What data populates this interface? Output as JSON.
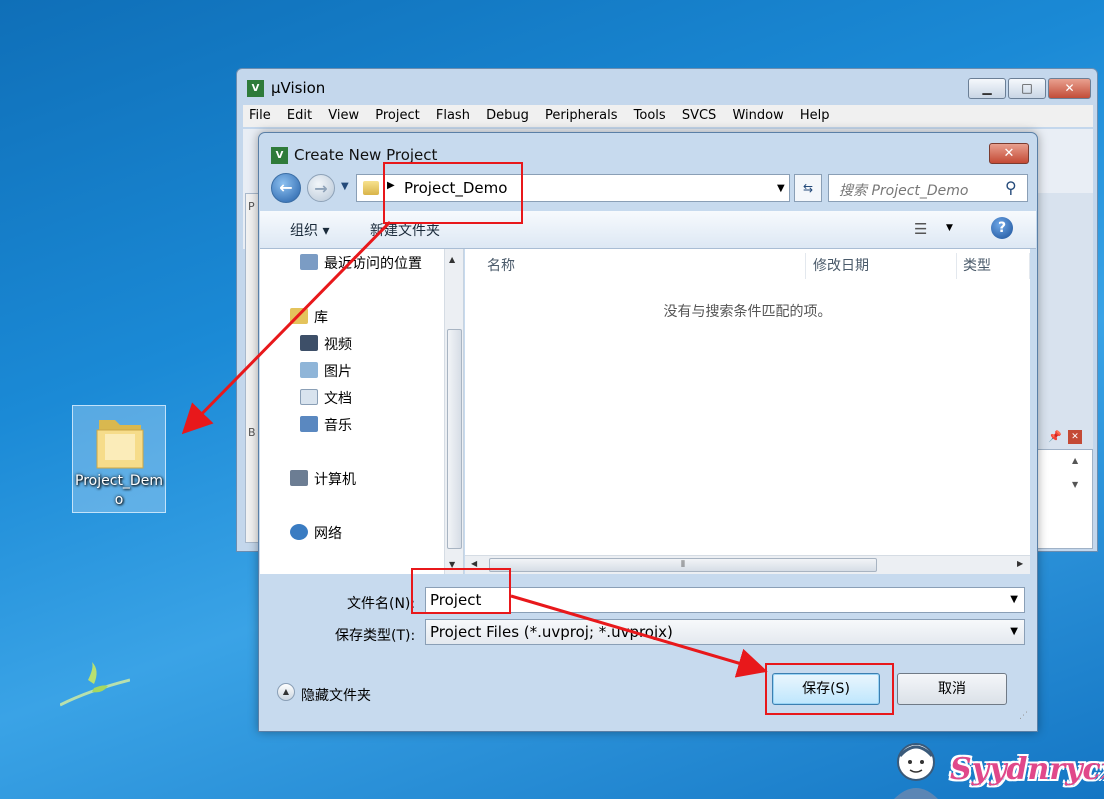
{
  "desktop": {
    "folder_label": "Project_Demo",
    "watermark": "Syydnrycx"
  },
  "uvision": {
    "title": "µVision",
    "menu": [
      "File",
      "Edit",
      "View",
      "Project",
      "Flash",
      "Debug",
      "Peripherals",
      "Tools",
      "SVCS",
      "Window",
      "Help"
    ],
    "panel_letters": [
      "P",
      "B"
    ]
  },
  "dialog": {
    "title": "Create New Project",
    "close_label": "✕",
    "address": "Project_Demo",
    "search_placeholder": "搜索 Project_Demo",
    "toolbar": {
      "organize": "组织 ▾",
      "new_folder": "新建文件夹"
    },
    "nav_items": [
      {
        "label": "最近访问的位置",
        "icon": "recent-places-icon"
      },
      {
        "label": "库",
        "icon": "library-icon"
      },
      {
        "label": "视频",
        "icon": "video-icon"
      },
      {
        "label": "图片",
        "icon": "pictures-icon"
      },
      {
        "label": "文档",
        "icon": "documents-icon"
      },
      {
        "label": "音乐",
        "icon": "music-icon"
      },
      {
        "label": "计算机",
        "icon": "computer-icon"
      },
      {
        "label": "网络",
        "icon": "network-icon"
      }
    ],
    "columns": [
      "名称",
      "修改日期",
      "类型"
    ],
    "empty_message": "没有与搜索条件匹配的项。",
    "filename_label": "文件名(N):",
    "filename_value": "Project",
    "filetype_label": "保存类型(T):",
    "filetype_value": "Project Files (*.uvproj; *.uvprojx)",
    "hide_folders": "隐藏文件夹",
    "save_button": "保存(S)",
    "cancel_button": "取消"
  },
  "colors": {
    "annotation_red": "#e8181b",
    "desktop_blue": "#1b8ad6"
  }
}
